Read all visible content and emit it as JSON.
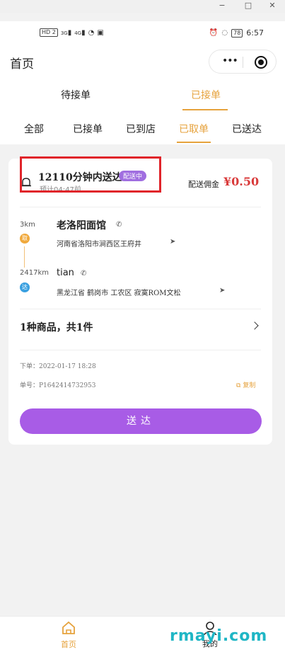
{
  "window": {
    "min": "−",
    "restore": "□",
    "close": "✕"
  },
  "status_bar": {
    "hd_badge": "HD 2",
    "signal_1": "3G",
    "signal_2": "4G",
    "battery": "78",
    "time": "6:57"
  },
  "header": {
    "title": "首页"
  },
  "tabs_primary": [
    {
      "label": "待接单",
      "active": false
    },
    {
      "label": "已接单",
      "active": true
    }
  ],
  "tabs_secondary": [
    {
      "label": "全部",
      "active": false
    },
    {
      "label": "已接单",
      "active": false
    },
    {
      "label": "已到店",
      "active": false
    },
    {
      "label": "已取单",
      "active": true
    },
    {
      "label": "已送达",
      "active": false
    }
  ],
  "order": {
    "eta": "12110分钟内送达",
    "status_badge": "配送中",
    "eta_sub": "预计04:47前",
    "commission_label": "配送佣金",
    "commission_value": "¥0.50",
    "pickup": {
      "distance": "3km",
      "marker": "取",
      "name": "老洛阳面馆",
      "address": "河南省洛阳市涧西区王府井"
    },
    "dropoff": {
      "distance": "2417km",
      "marker": "达",
      "name": "tian",
      "address": "黑龙江省 鹤岗市 工农区 寂寞ROM文松"
    },
    "goods_summary": "1种商品，共1件",
    "order_time": "下单：2022-01-17  18:28",
    "order_no": "单号：P1642414732953",
    "copy_label": "复制",
    "action_label": "送达"
  },
  "bottom_nav": [
    {
      "label": "首页",
      "active": true
    },
    {
      "label": "我的",
      "active": false
    }
  ],
  "watermark": "rmayi.com",
  "colors": {
    "accent": "#e6a23c",
    "purple": "#a85ce6",
    "price": "#d93a3a",
    "highlight": "#e0242a"
  }
}
